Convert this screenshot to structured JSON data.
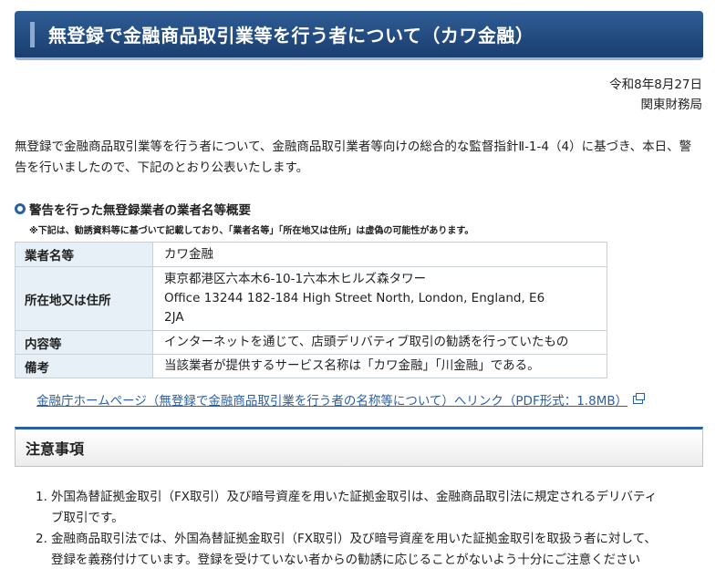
{
  "page": {
    "title": "無登録で金融商品取引業等を行う者について（カワ金融）",
    "date": "令和8年8月27日",
    "issuer": "関東財務局"
  },
  "intro": "無登録で金融商品取引業等を行う者について、金融商品取引業者等向けの総合的な監督指針Ⅱ-1-4（4）に基づき、本日、警告を行いましたので、下記のとおり公表いたします。",
  "summary": {
    "heading": "警告を行った無登録業者の業者名等概要",
    "note": "※下記は、勧誘資料等に基づいて記載しており、「業者名等」「所在地又は住所」は虚偽の可能性があります。",
    "rows": [
      {
        "label": "業者名等",
        "lines": [
          "カワ金融"
        ]
      },
      {
        "label": "所在地又は住所",
        "lines": [
          "東京都港区六本木6-10-1六本木ヒルズ森タワー",
          "Office 13244 182-184 High Street North, London, England, E6",
          "2JA"
        ]
      },
      {
        "label": "内容等",
        "lines": [
          "インターネットを通じて、店頭デリバティブ取引の勧誘を行っていたもの"
        ]
      },
      {
        "label": "備考",
        "lines": [
          "当該業者が提供するサービス名称は「カワ金融」「川金融」である。"
        ]
      }
    ]
  },
  "link": {
    "text": "金融庁ホームページ（無登録で金融商品取引業を行う者の名称等について）へリンク（PDF形式：1.8MB）"
  },
  "notices": {
    "heading": "注意事項",
    "items": [
      {
        "num": "1.",
        "lines": [
          "外国為替証拠金取引（FX取引）及び暗号資産を用いた証拠金取引は、金融商品取引法に規定されるデリバティ",
          "ブ取引です。"
        ]
      },
      {
        "num": "2.",
        "lines": [
          "金融商品取引法では、外国為替証拠金取引（FX取引）及び暗号資産を用いた証拠金取引を取扱う者に対して、",
          "登録を義務付けています。登録を受けていない者からの勧誘に応じることがないよう十分にご注意ください"
        ]
      }
    ]
  }
}
